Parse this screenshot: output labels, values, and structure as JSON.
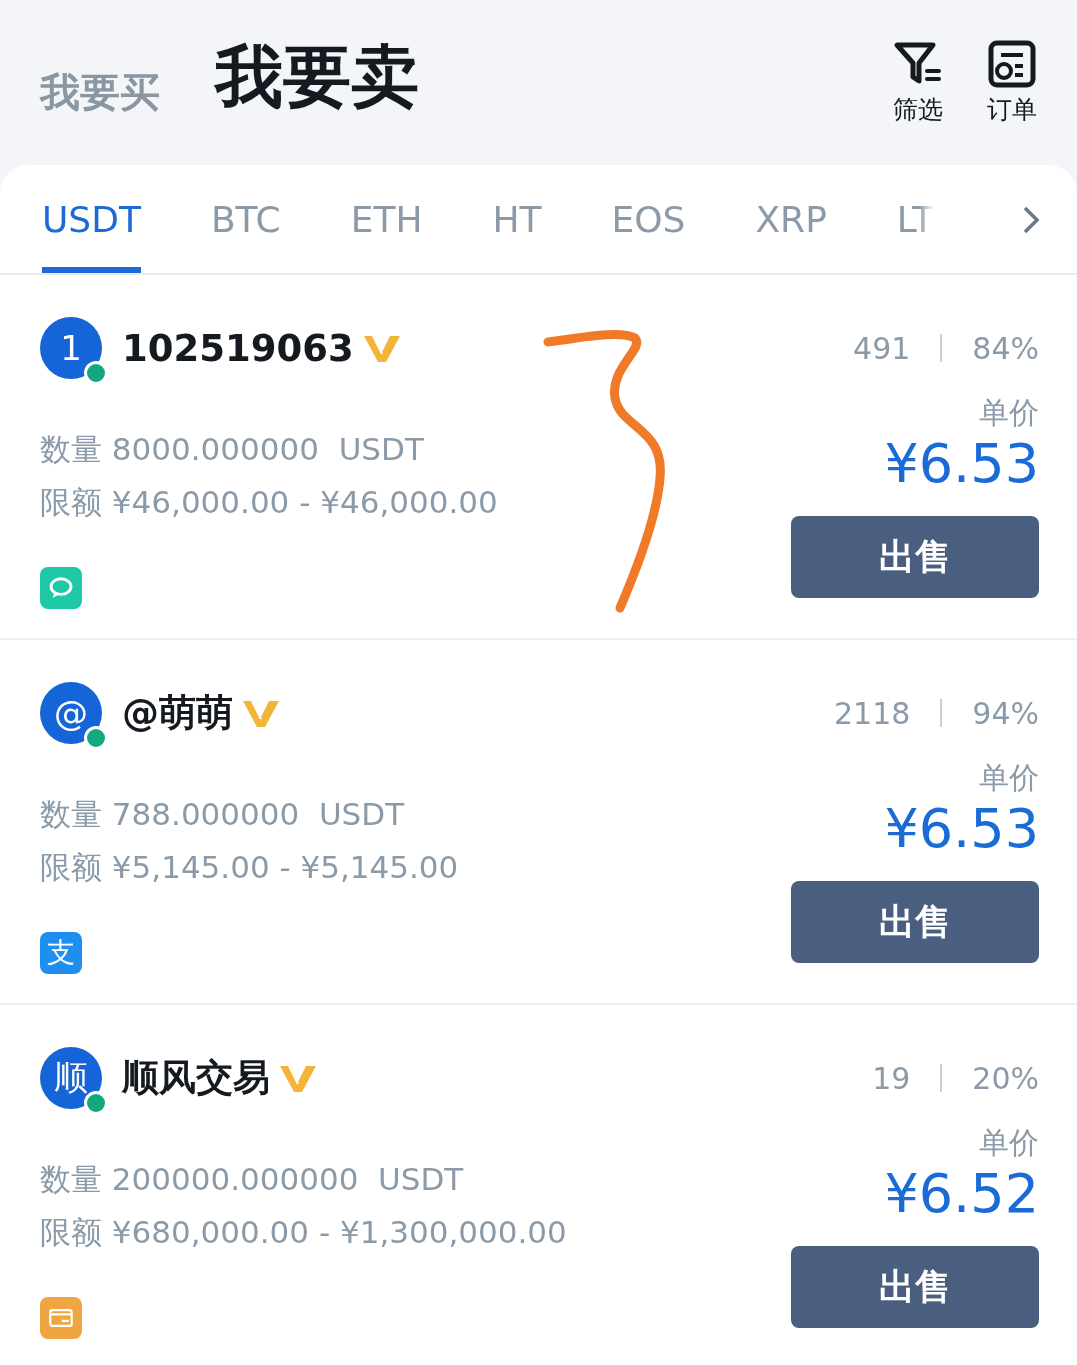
{
  "header": {
    "modes": [
      {
        "label": "我要买",
        "selected": false
      },
      {
        "label": "我要卖",
        "selected": true
      }
    ],
    "actions": [
      {
        "kind": "filter",
        "label": "筛选"
      },
      {
        "kind": "orders",
        "label": "订单"
      }
    ]
  },
  "tabs": [
    {
      "label": "USDT",
      "selected": true
    },
    {
      "label": "BTC",
      "selected": false
    },
    {
      "label": "ETH",
      "selected": false
    },
    {
      "label": "HT",
      "selected": false
    },
    {
      "label": "EOS",
      "selected": false
    },
    {
      "label": "XRP",
      "selected": false
    },
    {
      "label": "LT",
      "selected": false
    }
  ],
  "offers": [
    {
      "avatar": "1",
      "name": "102519063",
      "online": true,
      "verified": true,
      "orders": "491",
      "rate": "84%",
      "amount_label": "数量",
      "amount": "8000.000000  USDT",
      "limit_label": "限额",
      "limit": "¥46,000.00 - ¥46,000.00",
      "price_label": "单价",
      "price": "¥6.53",
      "payment": {
        "kind": "chat",
        "color": "#1fc8a6"
      },
      "button": "出售",
      "annotated": true
    },
    {
      "avatar": "@",
      "name": "@萌萌",
      "online": true,
      "verified": true,
      "orders": "2118",
      "rate": "94%",
      "amount_label": "数量",
      "amount": "788.000000  USDT",
      "limit_label": "限额",
      "limit": "¥5,145.00 - ¥5,145.00",
      "price_label": "单价",
      "price": "¥6.53",
      "payment": {
        "kind": "alipay",
        "label": "支",
        "color": "#1e8ff0"
      },
      "button": "出售"
    },
    {
      "avatar": "顺",
      "name": "顺风交易",
      "online": true,
      "verified": true,
      "orders": "19",
      "rate": "20%",
      "amount_label": "数量",
      "amount": "200000.000000  USDT",
      "limit_label": "限额",
      "limit": "¥680,000.00 - ¥1,300,000.00",
      "price_label": "单价",
      "price": "¥6.52",
      "payment": {
        "kind": "card",
        "color": "#f0a640"
      },
      "button": "出售"
    }
  ]
}
